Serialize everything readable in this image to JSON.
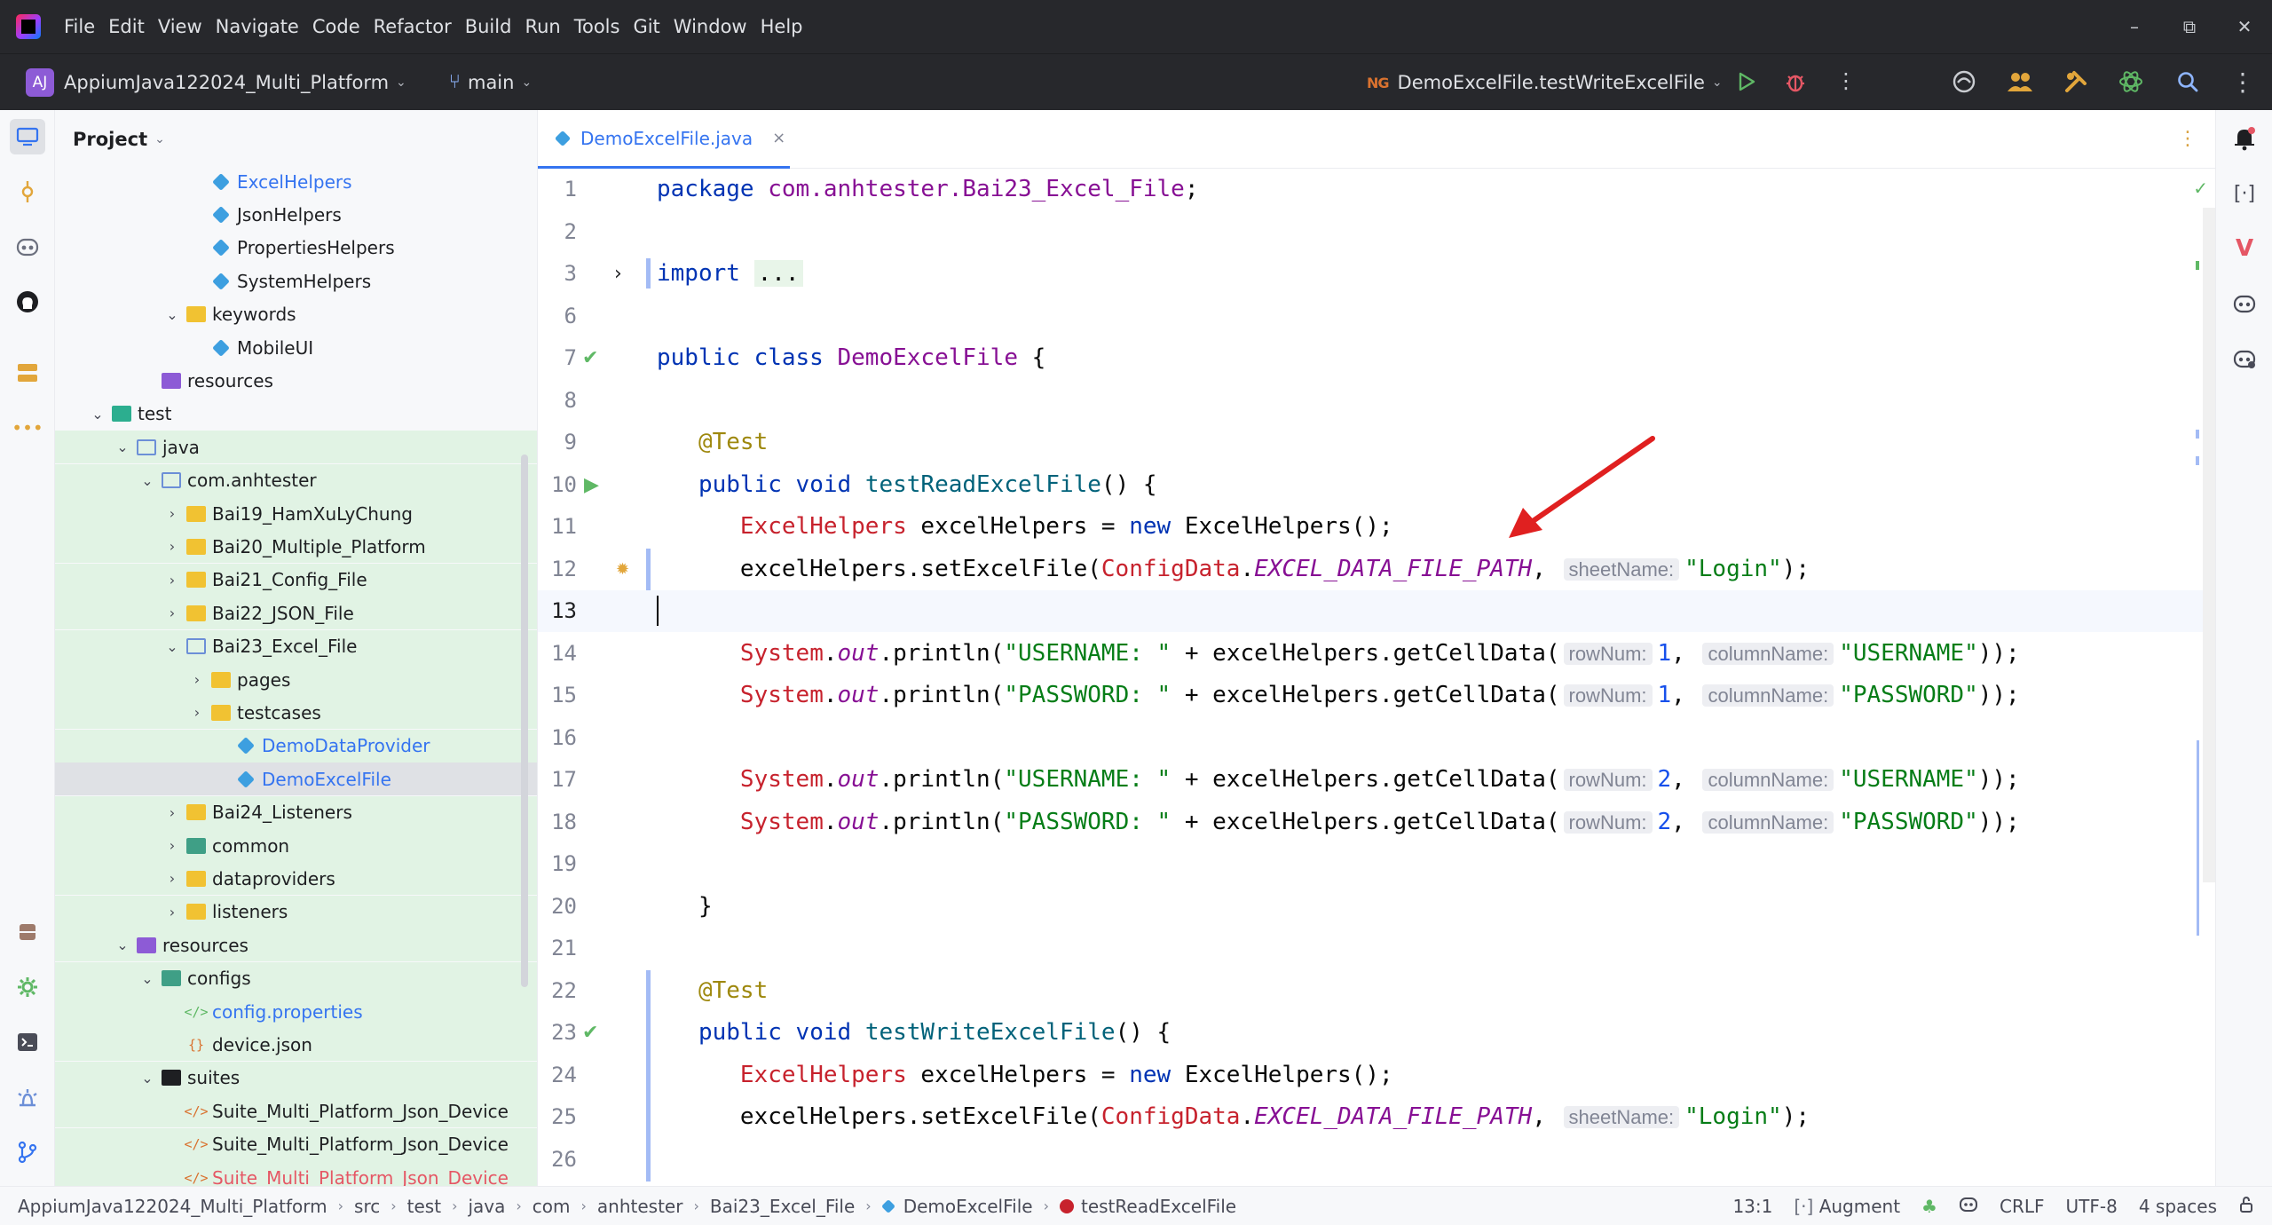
{
  "menu": [
    "File",
    "Edit",
    "View",
    "Navigate",
    "Code",
    "Refactor",
    "Build",
    "Run",
    "Tools",
    "Git",
    "Window",
    "Help"
  ],
  "window_controls": {
    "minimize": "–",
    "restore": "⧉",
    "close": "✕"
  },
  "toolbar": {
    "project_initials": "AJ",
    "project_name": "AppiumJava122024_Multi_Platform",
    "branch": "main",
    "run_config": "DemoExcelFile.testWriteExcelFile",
    "ng_icon": "NG",
    "run_icon": "play-icon",
    "debug_icon": "bug-icon"
  },
  "project_panel": {
    "title": "Project",
    "tree": [
      {
        "label": "ExcelHelpers",
        "indent": 6,
        "arrow": "",
        "icon": "class",
        "color": "blue"
      },
      {
        "label": "JsonHelpers",
        "indent": 6,
        "arrow": "",
        "icon": "class",
        "color": ""
      },
      {
        "label": "PropertiesHelpers",
        "indent": 6,
        "arrow": "",
        "icon": "class",
        "color": ""
      },
      {
        "label": "SystemHelpers",
        "indent": 6,
        "arrow": "",
        "icon": "class",
        "color": ""
      },
      {
        "label": "keywords",
        "indent": 5,
        "arrow": "⌄",
        "icon": "folder",
        "color": ""
      },
      {
        "label": "MobileUI",
        "indent": 6,
        "arrow": "",
        "icon": "class",
        "color": ""
      },
      {
        "label": "resources",
        "indent": 4,
        "arrow": "",
        "icon": "folder-res",
        "color": ""
      },
      {
        "label": "test",
        "indent": 2,
        "arrow": "⌄",
        "icon": "folder-test",
        "color": ""
      },
      {
        "label": "java",
        "indent": 3,
        "arrow": "⌄",
        "icon": "folder-pkg",
        "color": ""
      },
      {
        "label": "com.anhtester",
        "indent": 4,
        "arrow": "⌄",
        "icon": "folder-pkg",
        "color": ""
      },
      {
        "label": "Bai19_HamXuLyChung",
        "indent": 5,
        "arrow": "›",
        "icon": "folder",
        "color": ""
      },
      {
        "label": "Bai20_Multiple_Platform",
        "indent": 5,
        "arrow": "›",
        "icon": "folder",
        "color": ""
      },
      {
        "label": "Bai21_Config_File",
        "indent": 5,
        "arrow": "›",
        "icon": "folder",
        "color": ""
      },
      {
        "label": "Bai22_JSON_File",
        "indent": 5,
        "arrow": "›",
        "icon": "folder",
        "color": ""
      },
      {
        "label": "Bai23_Excel_File",
        "indent": 5,
        "arrow": "⌄",
        "icon": "folder-pkg",
        "color": ""
      },
      {
        "label": "pages",
        "indent": 6,
        "arrow": "›",
        "icon": "folder",
        "color": ""
      },
      {
        "label": "testcases",
        "indent": 6,
        "arrow": "›",
        "icon": "folder",
        "color": ""
      },
      {
        "label": "DemoDataProvider",
        "indent": 7,
        "arrow": "",
        "icon": "class",
        "color": "blue"
      },
      {
        "label": "DemoExcelFile",
        "indent": 7,
        "arrow": "",
        "icon": "class",
        "color": "blue",
        "selected": true
      },
      {
        "label": "Bai24_Listeners",
        "indent": 5,
        "arrow": "›",
        "icon": "folder",
        "color": ""
      },
      {
        "label": "common",
        "indent": 5,
        "arrow": "›",
        "icon": "folder-src",
        "color": ""
      },
      {
        "label": "dataproviders",
        "indent": 5,
        "arrow": "›",
        "icon": "folder",
        "color": ""
      },
      {
        "label": "listeners",
        "indent": 5,
        "arrow": "›",
        "icon": "folder",
        "color": ""
      },
      {
        "label": "resources",
        "indent": 3,
        "arrow": "⌄",
        "icon": "folder-res",
        "color": ""
      },
      {
        "label": "configs",
        "indent": 4,
        "arrow": "⌄",
        "icon": "folder-src",
        "color": ""
      },
      {
        "label": "config.properties",
        "indent": 5,
        "arrow": "",
        "icon": "props",
        "color": "blue"
      },
      {
        "label": "device.json",
        "indent": 5,
        "arrow": "",
        "icon": "json",
        "color": ""
      },
      {
        "label": "suites",
        "indent": 4,
        "arrow": "⌄",
        "icon": "folder-black",
        "color": ""
      },
      {
        "label": "Suite_Multi_Platform_Json_Device",
        "indent": 5,
        "arrow": "",
        "icon": "xml",
        "color": ""
      },
      {
        "label": "Suite_Multi_Platform_Json_Device",
        "indent": 5,
        "arrow": "",
        "icon": "xml",
        "color": ""
      },
      {
        "label": "Suite_Multi_Platform_Json_Device",
        "indent": 5,
        "arrow": "",
        "icon": "xml",
        "color": "red"
      }
    ]
  },
  "editor": {
    "tab": "DemoExcelFile.java",
    "tab_close": "×",
    "lines": [
      {
        "n": "1",
        "tokens": [
          [
            "kw",
            "package "
          ],
          [
            "cls",
            "com.anhtester.Bai23_Excel_File"
          ],
          [
            "",
            "; "
          ]
        ]
      },
      {
        "n": "2",
        "tokens": []
      },
      {
        "n": "3",
        "tokens": [
          [
            "kw",
            "import "
          ],
          [
            "fold",
            "..."
          ]
        ]
      },
      {
        "n": "6",
        "tokens": []
      },
      {
        "n": "7",
        "tokens": [
          [
            "kw",
            "public class "
          ],
          [
            "cls",
            "DemoExcelFile"
          ],
          [
            "",
            " {"
          ]
        ]
      },
      {
        "n": "8",
        "tokens": []
      },
      {
        "n": "9",
        "tokens": [
          [
            "",
            "   "
          ],
          [
            "ann",
            "@Test"
          ]
        ]
      },
      {
        "n": "10",
        "tokens": [
          [
            "",
            "   "
          ],
          [
            "kw",
            "public void "
          ],
          [
            "fn",
            "testReadExcelFile"
          ],
          [
            "",
            "() {"
          ]
        ]
      },
      {
        "n": "11",
        "tokens": [
          [
            "",
            "      "
          ],
          [
            "typ",
            "ExcelHelpers"
          ],
          [
            "",
            " excelHelpers = "
          ],
          [
            "kw",
            "new "
          ],
          [
            "",
            "ExcelHelpers();"
          ]
        ]
      },
      {
        "n": "12",
        "tokens": [
          [
            "",
            "      excelHelpers.setExcelFile("
          ],
          [
            "typ",
            "ConfigData"
          ],
          [
            "",
            "."
          ],
          [
            "static-f",
            "EXCEL_DATA_FILE_PATH"
          ],
          [
            "",
            ", "
          ],
          [
            "hint",
            "sheetName:"
          ],
          [
            "str",
            "\"Login\""
          ],
          [
            "",
            ");"
          ]
        ]
      },
      {
        "n": "13",
        "tokens": []
      },
      {
        "n": "14",
        "tokens": [
          [
            "",
            "      "
          ],
          [
            "typ",
            "System"
          ],
          [
            "",
            "."
          ],
          [
            "out-f",
            "out"
          ],
          [
            "",
            ".println("
          ],
          [
            "str",
            "\"USERNAME: \""
          ],
          [
            "",
            " + excelHelpers.getCellData("
          ],
          [
            "hint",
            "rowNum:"
          ],
          [
            "num",
            "1"
          ],
          [
            "",
            ", "
          ],
          [
            "hint",
            "columnName:"
          ],
          [
            "str",
            "\"USERNAME\""
          ],
          [
            "",
            "));"
          ]
        ]
      },
      {
        "n": "15",
        "tokens": [
          [
            "",
            "      "
          ],
          [
            "typ",
            "System"
          ],
          [
            "",
            "."
          ],
          [
            "out-f",
            "out"
          ],
          [
            "",
            ".println("
          ],
          [
            "str",
            "\"PASSWORD: \""
          ],
          [
            "",
            " + excelHelpers.getCellData("
          ],
          [
            "hint",
            "rowNum:"
          ],
          [
            "num",
            "1"
          ],
          [
            "",
            ", "
          ],
          [
            "hint",
            "columnName:"
          ],
          [
            "str",
            "\"PASSWORD\""
          ],
          [
            "",
            "));"
          ]
        ]
      },
      {
        "n": "16",
        "tokens": []
      },
      {
        "n": "17",
        "tokens": [
          [
            "",
            "      "
          ],
          [
            "typ",
            "System"
          ],
          [
            "",
            "."
          ],
          [
            "out-f",
            "out"
          ],
          [
            "",
            ".println("
          ],
          [
            "str",
            "\"USERNAME: \""
          ],
          [
            "",
            " + excelHelpers.getCellData("
          ],
          [
            "hint",
            "rowNum:"
          ],
          [
            "num",
            "2"
          ],
          [
            "",
            ", "
          ],
          [
            "hint",
            "columnName:"
          ],
          [
            "str",
            "\"USERNAME\""
          ],
          [
            "",
            "));"
          ]
        ]
      },
      {
        "n": "18",
        "tokens": [
          [
            "",
            "      "
          ],
          [
            "typ",
            "System"
          ],
          [
            "",
            "."
          ],
          [
            "out-f",
            "out"
          ],
          [
            "",
            ".println("
          ],
          [
            "str",
            "\"PASSWORD: \""
          ],
          [
            "",
            " + excelHelpers.getCellData("
          ],
          [
            "hint",
            "rowNum:"
          ],
          [
            "num",
            "2"
          ],
          [
            "",
            ", "
          ],
          [
            "hint",
            "columnName:"
          ],
          [
            "str",
            "\"PASSWORD\""
          ],
          [
            "",
            "));"
          ]
        ]
      },
      {
        "n": "19",
        "tokens": []
      },
      {
        "n": "20",
        "tokens": [
          [
            "",
            "   }"
          ]
        ]
      },
      {
        "n": "21",
        "tokens": []
      },
      {
        "n": "22",
        "tokens": [
          [
            "",
            "   "
          ],
          [
            "ann",
            "@Test"
          ]
        ]
      },
      {
        "n": "23",
        "tokens": [
          [
            "",
            "   "
          ],
          [
            "kw",
            "public void "
          ],
          [
            "fn",
            "testWriteExcelFile"
          ],
          [
            "",
            "() {"
          ]
        ]
      },
      {
        "n": "24",
        "tokens": [
          [
            "",
            "      "
          ],
          [
            "typ",
            "ExcelHelpers"
          ],
          [
            "",
            " excelHelpers = "
          ],
          [
            "kw",
            "new "
          ],
          [
            "",
            "ExcelHelpers();"
          ]
        ]
      },
      {
        "n": "25",
        "tokens": [
          [
            "",
            "      excelHelpers.setExcelFile("
          ],
          [
            "typ",
            "ConfigData"
          ],
          [
            "",
            "."
          ],
          [
            "static-f",
            "EXCEL_DATA_FILE_PATH"
          ],
          [
            "",
            ", "
          ],
          [
            "hint",
            "sheetName:"
          ],
          [
            "str",
            "\"Login\""
          ],
          [
            "",
            ");"
          ]
        ]
      },
      {
        "n": "26",
        "tokens": []
      }
    ]
  },
  "statusbar": {
    "breadcrumbs": [
      "AppiumJava122024_Multi_Platform",
      "src",
      "test",
      "java",
      "com",
      "anhtester",
      "Bai23_Excel_File",
      "DemoExcelFile",
      "testReadExcelFile"
    ],
    "position": "13:1",
    "augment": "Augment",
    "line_separator": "CRLF",
    "encoding": "UTF-8",
    "indent": "4 spaces"
  },
  "colors": {
    "accent": "#3574f0",
    "annotation_arrow": "#e02020",
    "dark_bar": "#27282c",
    "project_tree_highlight": "#e1f3e4"
  }
}
